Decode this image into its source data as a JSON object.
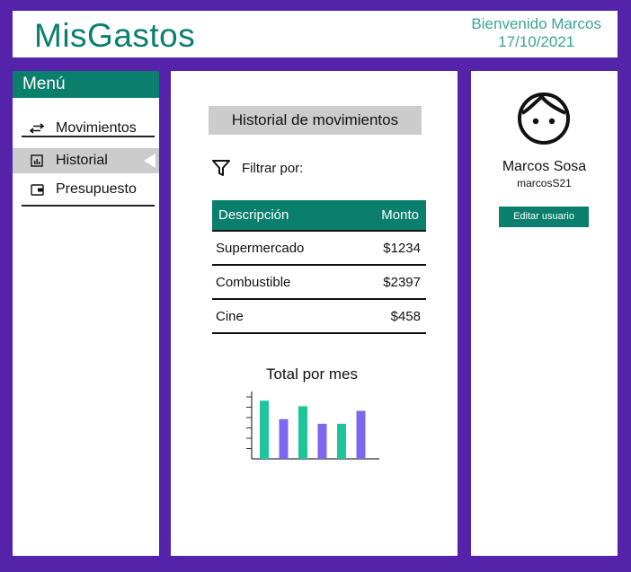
{
  "app": {
    "title": "MisGastos"
  },
  "header": {
    "welcome": "Bienvenido Marcos",
    "date": "17/10/2021"
  },
  "menu": {
    "title": "Menú",
    "items": [
      {
        "label": "Movimientos",
        "icon": "swap-arrows-icon"
      },
      {
        "label": "Historial",
        "icon": "chart-icon",
        "active": true
      },
      {
        "label": "Presupuesto",
        "icon": "wallet-icon"
      }
    ]
  },
  "main": {
    "section_title": "Historial de movimientos",
    "filter_label": "Filtrar por:",
    "table": {
      "headers": [
        "Descripción",
        "Monto"
      ],
      "rows": [
        {
          "description": "Supermercado",
          "amount": "$1234"
        },
        {
          "description": "Combustible",
          "amount": "$2397"
        },
        {
          "description": "Cine",
          "amount": "$458"
        }
      ]
    }
  },
  "chart_data": {
    "type": "bar",
    "title": "Total por mes",
    "xlabel": "",
    "ylabel": "",
    "ylim": [
      0,
      7
    ],
    "values": [
      6.3,
      4.3,
      5.7,
      3.8,
      3.8,
      5.2
    ],
    "colors": [
      "#1ec49a",
      "#7b68ee",
      "#1ec49a",
      "#7b68ee",
      "#1ec49a",
      "#7b68ee"
    ]
  },
  "profile": {
    "name": "Marcos Sosa",
    "username": "marcosS21",
    "edit_label": "Editar usuario",
    "avatar_icon": "face-icon"
  },
  "colors": {
    "accent": "#0b7f6e",
    "frame": "#5522aa",
    "bar_green": "#1ec49a",
    "bar_purple": "#7b68ee"
  }
}
